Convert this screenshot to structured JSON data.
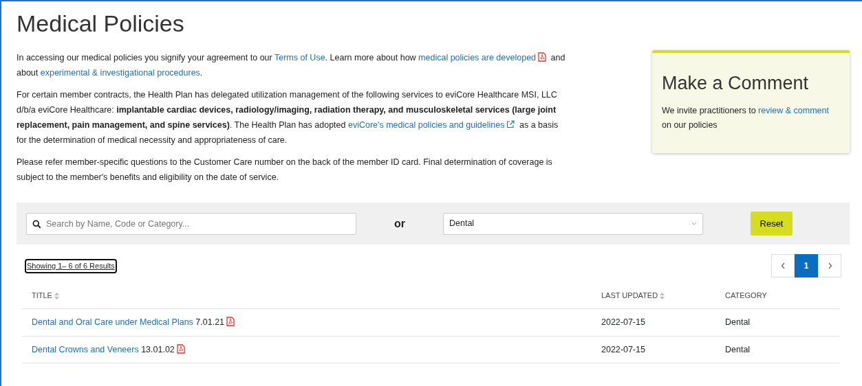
{
  "title": "Medical Policies",
  "intro": [
    [
      {
        "kind": "text",
        "text": "In accessing our medical policies you signify your agreement to our "
      },
      {
        "kind": "link",
        "text": "Terms of Use"
      },
      {
        "kind": "text",
        "text": ". Learn more about how "
      },
      {
        "kind": "pdf_link",
        "text": "medical policies are developed"
      },
      {
        "kind": "text",
        "text": " and about "
      },
      {
        "kind": "link",
        "text": "experimental & investigational procedures"
      },
      {
        "kind": "text",
        "text": "."
      }
    ],
    [
      {
        "kind": "text",
        "text": "For certain member contracts, the Health Plan has delegated utilization management of the following services to eviCore Healthcare MSI, LLC d/b/a eviCore Healthcare: **implantable cardiac devices, radiology/imaging, radiation therapy, and musculoskeletal services (large joint replacement, pain management, and spine services)**. The Health Plan has adopted "
      },
      {
        "kind": "external_link",
        "text": "eviCore's medical policies and guidelines"
      },
      {
        "kind": "text",
        "text": " as a basis for the determination of medical necessity and appropriateness of care."
      }
    ],
    [
      {
        "kind": "text",
        "text": "Please refer member-specific questions to the Customer Care number on the back of the member ID card. Final determination of coverage is subject to the member's benefits and eligibility on the date of service."
      }
    ]
  ],
  "comment_card": {
    "title": "Make a Comment",
    "body": [
      {
        "kind": "text",
        "text": "We invite practitioners to "
      },
      {
        "kind": "link",
        "text": "review & comment"
      },
      {
        "kind": "text",
        "text": " on our policies"
      }
    ]
  },
  "filters": {
    "search": {
      "placeholder": "Search by Name, Code or Category..."
    },
    "separator": "or",
    "category": {
      "value": "Dental"
    },
    "reset_button": "Reset"
  },
  "results_summary": "Showing 1– 6 of 6 Results",
  "pagination": {
    "pages": [
      {
        "label": "1",
        "selected": true
      }
    ]
  },
  "table": {
    "columns": [
      {
        "label": "TITLE",
        "sortable": true
      },
      {
        "label": "LAST UPDATED",
        "sortable": true
      },
      {
        "label": "CATEGORY",
        "sortable": false
      }
    ],
    "rows": [
      {
        "title": "Dental and Oral Care under Medical Plans",
        "code": "7.01.21",
        "updated": "2022-07-15",
        "category": "Dental"
      },
      {
        "title": "Dental Crowns and Veneers",
        "code": "13.01.02",
        "updated": "2022-07-15",
        "category": "Dental"
      }
    ]
  }
}
